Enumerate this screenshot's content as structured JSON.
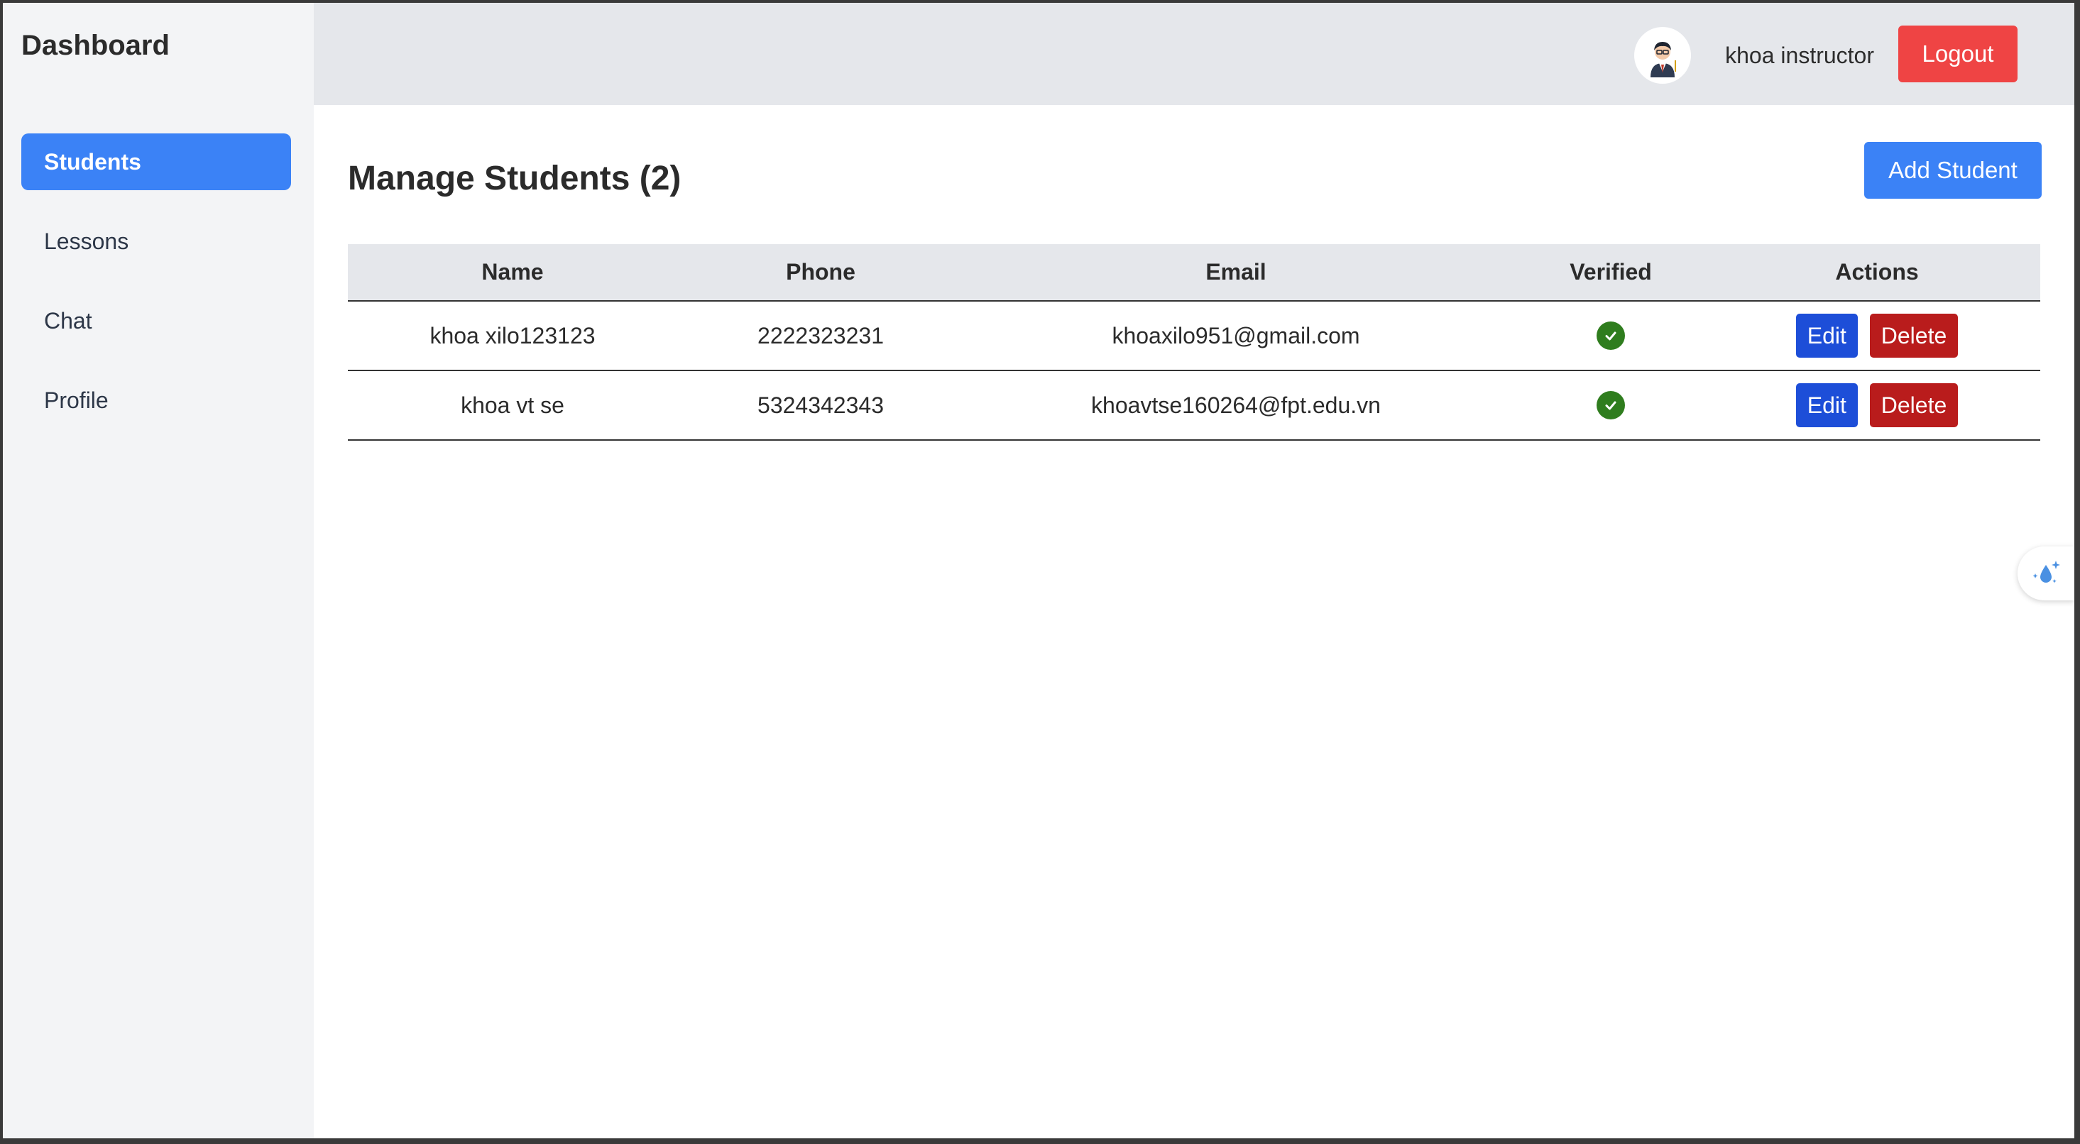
{
  "sidebar": {
    "brand": "Dashboard",
    "items": [
      {
        "label": "Students",
        "active": true
      },
      {
        "label": "Lessons"
      },
      {
        "label": "Chat"
      },
      {
        "label": "Profile"
      }
    ]
  },
  "header": {
    "username": "khoa instructor",
    "logout_label": "Logout"
  },
  "main": {
    "title": "Manage Students (2)",
    "add_label": "Add Student",
    "table": {
      "columns": [
        "Name",
        "Phone",
        "Email",
        "Verified",
        "Actions"
      ],
      "rows": [
        {
          "name": "khoa xilo123123",
          "phone": "2222323231",
          "email": "khoaxilo951@gmail.com",
          "verified": true,
          "edit": "Edit",
          "delete": "Delete"
        },
        {
          "name": "khoa vt se",
          "phone": "5324342343",
          "email": "khoavtse160264@fpt.edu.vn",
          "verified": true,
          "edit": "Edit",
          "delete": "Delete"
        }
      ]
    }
  },
  "colors": {
    "accent": "#3b82f6",
    "danger": "#ef4444",
    "verified": "#2f7d1e"
  }
}
